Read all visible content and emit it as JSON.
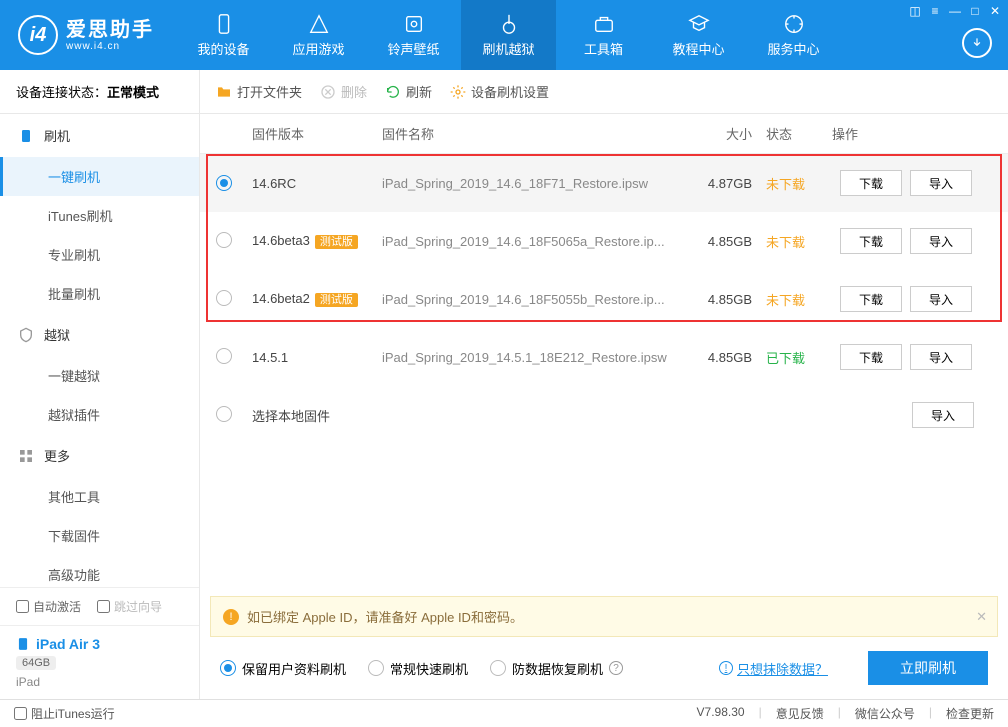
{
  "header": {
    "logo_title": "爱思助手",
    "logo_sub": "www.i4.cn",
    "nav": [
      {
        "label": "我的设备"
      },
      {
        "label": "应用游戏"
      },
      {
        "label": "铃声壁纸"
      },
      {
        "label": "刷机越狱"
      },
      {
        "label": "工具箱"
      },
      {
        "label": "教程中心"
      },
      {
        "label": "服务中心"
      }
    ]
  },
  "sidebar": {
    "status_label": "设备连接状态：",
    "status_value": "正常模式",
    "groups": {
      "flash": "刷机",
      "flash_items": [
        "一键刷机",
        "iTunes刷机",
        "专业刷机",
        "批量刷机"
      ],
      "jailbreak": "越狱",
      "jailbreak_items": [
        "一键越狱",
        "越狱插件"
      ],
      "more": "更多",
      "more_items": [
        "其他工具",
        "下载固件",
        "高级功能"
      ]
    },
    "auto_activate": "自动激活",
    "skip_guide": "跳过向导",
    "device": {
      "name": "iPad Air 3",
      "capacity": "64GB",
      "type": "iPad"
    }
  },
  "toolbar": {
    "open_folder": "打开文件夹",
    "delete": "删除",
    "refresh": "刷新",
    "settings": "设备刷机设置"
  },
  "table": {
    "head": {
      "version": "固件版本",
      "name": "固件名称",
      "size": "大小",
      "status": "状态",
      "actions": "操作"
    },
    "btn_download": "下载",
    "btn_import": "导入",
    "rows": [
      {
        "selected": true,
        "version": "14.6RC",
        "beta": false,
        "name": "iPad_Spring_2019_14.6_18F71_Restore.ipsw",
        "size": "4.87GB",
        "status": "未下载",
        "status_cls": "warn"
      },
      {
        "selected": false,
        "version": "14.6beta3",
        "beta": true,
        "name": "iPad_Spring_2019_14.6_18F5065a_Restore.ip...",
        "size": "4.85GB",
        "status": "未下载",
        "status_cls": "warn"
      },
      {
        "selected": false,
        "version": "14.6beta2",
        "beta": true,
        "name": "iPad_Spring_2019_14.6_18F5055b_Restore.ip...",
        "size": "4.85GB",
        "status": "未下载",
        "status_cls": "warn"
      },
      {
        "selected": false,
        "version": "14.5.1",
        "beta": false,
        "name": "iPad_Spring_2019_14.5.1_18E212_Restore.ipsw",
        "size": "4.85GB",
        "status": "已下载",
        "status_cls": "ok"
      }
    ],
    "local_row": "选择本地固件",
    "beta_badge": "测试版"
  },
  "tip": "如已绑定 Apple ID，请准备好 Apple ID和密码。",
  "modes": {
    "opt1": "保留用户资料刷机",
    "opt2": "常规快速刷机",
    "opt3": "防数据恢复刷机",
    "link": "只想抹除数据？",
    "flash_btn": "立即刷机"
  },
  "footer": {
    "block_itunes": "阻止iTunes运行",
    "version": "V7.98.30",
    "feedback": "意见反馈",
    "wechat": "微信公众号",
    "check_update": "检查更新"
  }
}
